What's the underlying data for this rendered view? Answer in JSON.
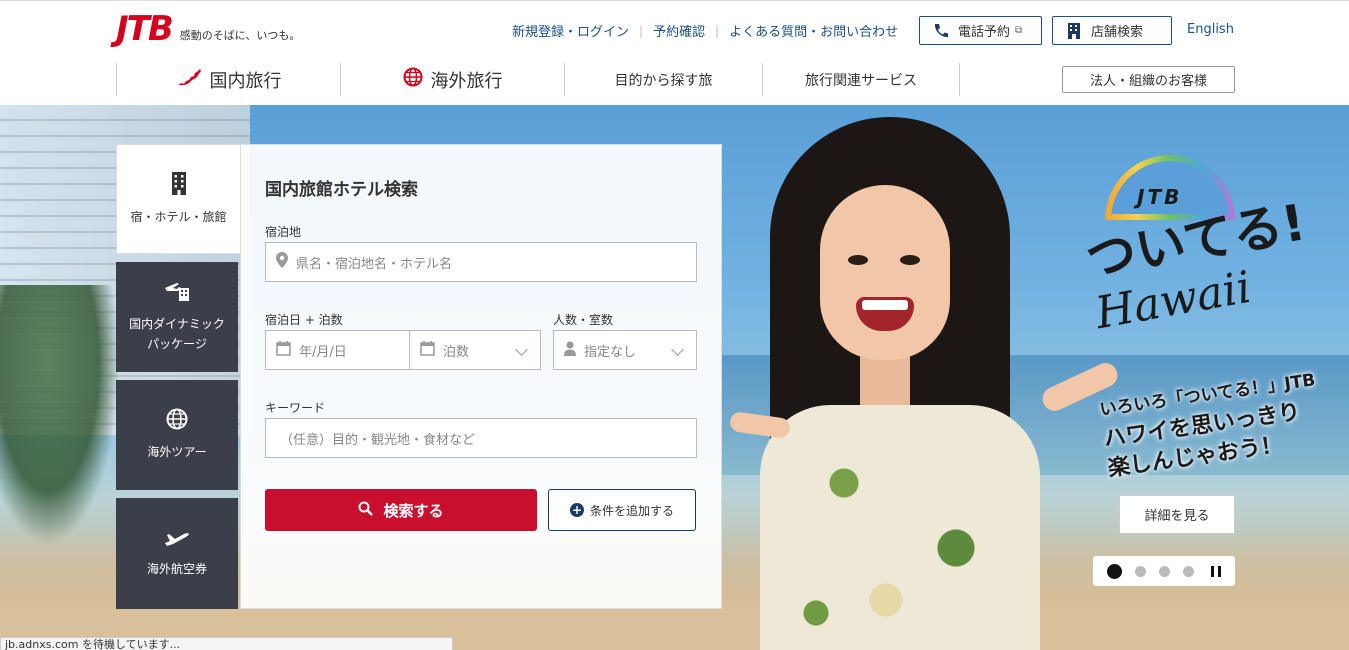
{
  "header": {
    "logo": {
      "mark": "JTB",
      "tagline": "感動のそばに、いつも。"
    },
    "util_links": [
      "新規登録・ログイン",
      "予約確認",
      "よくある質問・お問い合わせ"
    ],
    "phone_btn": "電話予約",
    "store_btn": "店舗検索",
    "english": "English",
    "gnav": [
      {
        "label": "国内旅行",
        "icon": "japan-map-icon"
      },
      {
        "label": "海外旅行",
        "icon": "globe-icon"
      },
      {
        "label": "目的から探す旅"
      },
      {
        "label": "旅行関連サービス"
      }
    ],
    "corp_btn": "法人・組織のお客様"
  },
  "search": {
    "tabs": [
      {
        "label": "宿・ホテル・旅館",
        "icon": "building-icon",
        "active": true
      },
      {
        "label": "国内ダイナミック\nパッケージ",
        "icon": "plane-hotel-icon"
      },
      {
        "label": "海外ツアー",
        "icon": "globe-icon"
      },
      {
        "label": "海外航空券",
        "icon": "airplane-icon"
      }
    ],
    "title": "国内旅館ホテル検索",
    "place_label": "宿泊地",
    "place_placeholder": "県名・宿泊地名・ホテル名",
    "date_label": "宿泊日 + 泊数",
    "date_placeholder": "年/月/日",
    "nights_placeholder": "泊数",
    "guests_label": "人数・室数",
    "guests_placeholder": "指定なし",
    "keyword_label": "キーワード",
    "keyword_placeholder": "（任意）目的・観光地・食材など",
    "search_btn": "検索する",
    "add_btn": "条件を追加する"
  },
  "campaign": {
    "brand": "JTB",
    "title": "ついてる!",
    "subtitle": "Hawaii",
    "copy": [
      "いろいろ「ついてる！」JTB",
      "ハワイを思いっきり",
      "楽しんじゃおう！"
    ],
    "detail_btn": "詳細を見る",
    "slides": 4,
    "active_slide": 1
  },
  "status": "jb.adnxs.com を待機しています...",
  "colors": {
    "brand_red": "#d7001c",
    "search_red": "#c8102e",
    "navy": "#1a3a66",
    "link": "#1a4f8b",
    "tab_dark": "#3a3f4a"
  }
}
